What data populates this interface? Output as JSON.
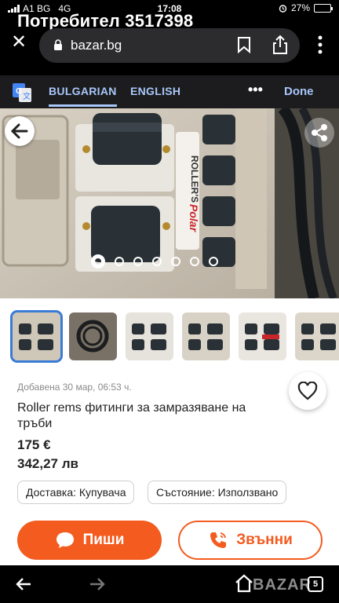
{
  "status_bar": {
    "carrier": "A1 BG",
    "network": "4G",
    "time": "17:08",
    "battery_percent": "27%",
    "battery_level": 0.27
  },
  "browser": {
    "page_title": "Потребител 3517398",
    "url": "bazar.bg",
    "close_icon": "close-icon",
    "lock_icon": "lock-icon",
    "bookmark_icon": "bookmark-icon",
    "share_icon": "share-icon",
    "menu_icon": "more-vertical-icon"
  },
  "translate_bar": {
    "icon": "google-translate-icon",
    "languages": [
      "BULGARIAN",
      "ENGLISH"
    ],
    "active_language": "BULGARIAN",
    "more_label": "•••",
    "done_label": "Done",
    "accent": "#a8c7fa"
  },
  "gallery": {
    "back_icon": "arrow-left-icon",
    "share_icon": "share-network-icon",
    "brand_text": "ROLLER'S Polar",
    "dot_count": 7,
    "active_index": 0,
    "thumbnails": 6,
    "selected_thumbnail": 0
  },
  "listing": {
    "date": "Добавена 30 мар, 06:53 ч.",
    "title": "Roller rems фитинги за замразяване на тръби",
    "price_eur": "175 €",
    "price_bgn": "342,27 лв",
    "delivery_chip": "Доставка: Купувача",
    "condition_chip": "Състояние: Използвано",
    "favorite_icon": "heart-outline-icon",
    "write_label": "Пиши",
    "write_icon": "chat-bubble-icon",
    "call_label": "Звънни",
    "call_icon": "phone-icon",
    "accent": "#f35b1f"
  },
  "bottom_bar": {
    "back_icon": "arrow-left-icon",
    "forward_icon": "arrow-right-icon",
    "home_icon": "home-icon",
    "tab_count": "5",
    "watermark": "BAZAR"
  }
}
